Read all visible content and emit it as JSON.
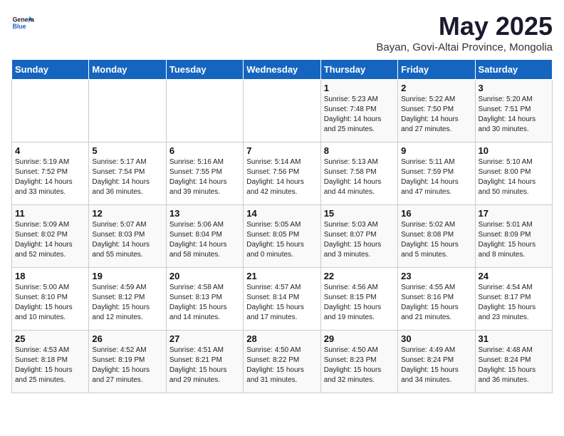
{
  "logo": {
    "general": "General",
    "blue": "Blue"
  },
  "title": "May 2025",
  "subtitle": "Bayan, Govi-Altai Province, Mongolia",
  "headers": [
    "Sunday",
    "Monday",
    "Tuesday",
    "Wednesday",
    "Thursday",
    "Friday",
    "Saturday"
  ],
  "weeks": [
    [
      {
        "day": "",
        "info": ""
      },
      {
        "day": "",
        "info": ""
      },
      {
        "day": "",
        "info": ""
      },
      {
        "day": "",
        "info": ""
      },
      {
        "day": "1",
        "info": "Sunrise: 5:23 AM\nSunset: 7:48 PM\nDaylight: 14 hours\nand 25 minutes."
      },
      {
        "day": "2",
        "info": "Sunrise: 5:22 AM\nSunset: 7:50 PM\nDaylight: 14 hours\nand 27 minutes."
      },
      {
        "day": "3",
        "info": "Sunrise: 5:20 AM\nSunset: 7:51 PM\nDaylight: 14 hours\nand 30 minutes."
      }
    ],
    [
      {
        "day": "4",
        "info": "Sunrise: 5:19 AM\nSunset: 7:52 PM\nDaylight: 14 hours\nand 33 minutes."
      },
      {
        "day": "5",
        "info": "Sunrise: 5:17 AM\nSunset: 7:54 PM\nDaylight: 14 hours\nand 36 minutes."
      },
      {
        "day": "6",
        "info": "Sunrise: 5:16 AM\nSunset: 7:55 PM\nDaylight: 14 hours\nand 39 minutes."
      },
      {
        "day": "7",
        "info": "Sunrise: 5:14 AM\nSunset: 7:56 PM\nDaylight: 14 hours\nand 42 minutes."
      },
      {
        "day": "8",
        "info": "Sunrise: 5:13 AM\nSunset: 7:58 PM\nDaylight: 14 hours\nand 44 minutes."
      },
      {
        "day": "9",
        "info": "Sunrise: 5:11 AM\nSunset: 7:59 PM\nDaylight: 14 hours\nand 47 minutes."
      },
      {
        "day": "10",
        "info": "Sunrise: 5:10 AM\nSunset: 8:00 PM\nDaylight: 14 hours\nand 50 minutes."
      }
    ],
    [
      {
        "day": "11",
        "info": "Sunrise: 5:09 AM\nSunset: 8:02 PM\nDaylight: 14 hours\nand 52 minutes."
      },
      {
        "day": "12",
        "info": "Sunrise: 5:07 AM\nSunset: 8:03 PM\nDaylight: 14 hours\nand 55 minutes."
      },
      {
        "day": "13",
        "info": "Sunrise: 5:06 AM\nSunset: 8:04 PM\nDaylight: 14 hours\nand 58 minutes."
      },
      {
        "day": "14",
        "info": "Sunrise: 5:05 AM\nSunset: 8:05 PM\nDaylight: 15 hours\nand 0 minutes."
      },
      {
        "day": "15",
        "info": "Sunrise: 5:03 AM\nSunset: 8:07 PM\nDaylight: 15 hours\nand 3 minutes."
      },
      {
        "day": "16",
        "info": "Sunrise: 5:02 AM\nSunset: 8:08 PM\nDaylight: 15 hours\nand 5 minutes."
      },
      {
        "day": "17",
        "info": "Sunrise: 5:01 AM\nSunset: 8:09 PM\nDaylight: 15 hours\nand 8 minutes."
      }
    ],
    [
      {
        "day": "18",
        "info": "Sunrise: 5:00 AM\nSunset: 8:10 PM\nDaylight: 15 hours\nand 10 minutes."
      },
      {
        "day": "19",
        "info": "Sunrise: 4:59 AM\nSunset: 8:12 PM\nDaylight: 15 hours\nand 12 minutes."
      },
      {
        "day": "20",
        "info": "Sunrise: 4:58 AM\nSunset: 8:13 PM\nDaylight: 15 hours\nand 14 minutes."
      },
      {
        "day": "21",
        "info": "Sunrise: 4:57 AM\nSunset: 8:14 PM\nDaylight: 15 hours\nand 17 minutes."
      },
      {
        "day": "22",
        "info": "Sunrise: 4:56 AM\nSunset: 8:15 PM\nDaylight: 15 hours\nand 19 minutes."
      },
      {
        "day": "23",
        "info": "Sunrise: 4:55 AM\nSunset: 8:16 PM\nDaylight: 15 hours\nand 21 minutes."
      },
      {
        "day": "24",
        "info": "Sunrise: 4:54 AM\nSunset: 8:17 PM\nDaylight: 15 hours\nand 23 minutes."
      }
    ],
    [
      {
        "day": "25",
        "info": "Sunrise: 4:53 AM\nSunset: 8:18 PM\nDaylight: 15 hours\nand 25 minutes."
      },
      {
        "day": "26",
        "info": "Sunrise: 4:52 AM\nSunset: 8:19 PM\nDaylight: 15 hours\nand 27 minutes."
      },
      {
        "day": "27",
        "info": "Sunrise: 4:51 AM\nSunset: 8:21 PM\nDaylight: 15 hours\nand 29 minutes."
      },
      {
        "day": "28",
        "info": "Sunrise: 4:50 AM\nSunset: 8:22 PM\nDaylight: 15 hours\nand 31 minutes."
      },
      {
        "day": "29",
        "info": "Sunrise: 4:50 AM\nSunset: 8:23 PM\nDaylight: 15 hours\nand 32 minutes."
      },
      {
        "day": "30",
        "info": "Sunrise: 4:49 AM\nSunset: 8:24 PM\nDaylight: 15 hours\nand 34 minutes."
      },
      {
        "day": "31",
        "info": "Sunrise: 4:48 AM\nSunset: 8:24 PM\nDaylight: 15 hours\nand 36 minutes."
      }
    ]
  ]
}
